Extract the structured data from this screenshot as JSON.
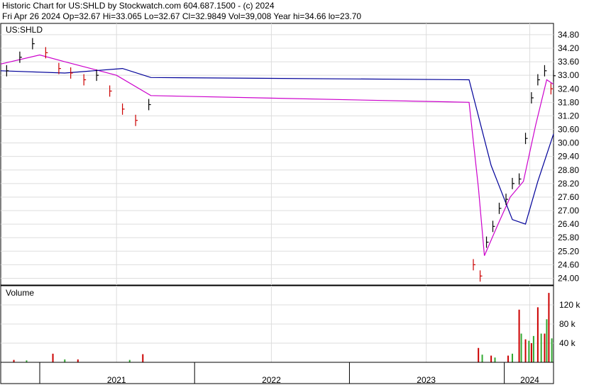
{
  "header": {
    "line1": "Historic Chart for US:SHLD by Stockwatch.com 604.687.1500 - (c) 2024",
    "line2": "Fri Apr 26 2024   Op=32.67  Hi=33.065  Lo=32.67  Cl=32.9849  Vol=39,008  Year hi=34.66  lo=23.70"
  },
  "colors": {
    "price_up": "#000000",
    "price_down": "#cc0000",
    "ma_short": "#cc00cc",
    "ma_long": "#000099",
    "vol_up": "#33aa33",
    "vol_down": "#cc0000",
    "grid": "#dddddd"
  },
  "chart_data": [
    {
      "type": "candlestick",
      "title": "US:SHLD",
      "y_ticks": [
        "34.80",
        "34.20",
        "33.60",
        "33.00",
        "32.40",
        "31.80",
        "31.20",
        "30.60",
        "30.00",
        "29.40",
        "28.80",
        "28.20",
        "27.60",
        "27.00",
        "26.40",
        "25.80",
        "25.20",
        "24.60",
        "24.00"
      ],
      "ylim": [
        23.7,
        35.3
      ],
      "x_ticks": [
        "2021",
        "2022",
        "2023",
        "2024"
      ],
      "x_tick_dates": [
        "2021-07-01",
        "2022-07-01",
        "2023-07-01",
        "2024-03-01"
      ],
      "date_range": [
        "2020-10-01",
        "2024-04-26"
      ],
      "grid": true,
      "series": [
        {
          "name": "",
          "kind": "price",
          "x": [
            "2020-10-15",
            "2020-11-15",
            "2020-12-15",
            "2021-01-15",
            "2021-02-15",
            "2021-03-15",
            "2021-04-15",
            "2021-05-15",
            "2021-06-15",
            "2021-07-15",
            "2021-08-15",
            "2021-09-15",
            "2023-10-20",
            "2023-11-05",
            "2023-11-20",
            "2023-12-05",
            "2023-12-20",
            "2024-01-05",
            "2024-01-20",
            "2024-02-05",
            "2024-02-20",
            "2024-03-05",
            "2024-03-20",
            "2024-04-05",
            "2024-04-20",
            "2024-04-26"
          ],
          "y": [
            33.2,
            33.8,
            34.4,
            34.0,
            33.3,
            33.1,
            32.8,
            33.0,
            32.3,
            31.5,
            31.0,
            31.7,
            24.6,
            24.1,
            25.6,
            26.3,
            27.1,
            27.5,
            28.2,
            28.4,
            30.2,
            32.0,
            32.8,
            33.2,
            32.4,
            32.98
          ]
        },
        {
          "name": "",
          "kind": "ma_short",
          "x": [
            "2020-10-01",
            "2021-01-01",
            "2021-03-01",
            "2021-05-01",
            "2021-07-01",
            "2021-09-20",
            "2023-10-10",
            "2023-11-01",
            "2023-11-15",
            "2023-12-15",
            "2024-01-15",
            "2024-02-15",
            "2024-03-15",
            "2024-04-10",
            "2024-04-26"
          ],
          "y": [
            33.5,
            33.9,
            33.6,
            33.3,
            33.0,
            32.1,
            31.8,
            28.0,
            25.0,
            26.3,
            27.6,
            28.3,
            30.8,
            32.8,
            32.6
          ]
        },
        {
          "name": "",
          "kind": "ma_long",
          "x": [
            "2020-10-01",
            "2021-03-01",
            "2021-07-15",
            "2021-09-20",
            "2023-10-10",
            "2023-12-01",
            "2024-01-20",
            "2024-02-20",
            "2024-03-20",
            "2024-04-26"
          ],
          "y": [
            33.2,
            33.1,
            33.3,
            32.9,
            32.8,
            29.0,
            26.6,
            26.4,
            28.3,
            30.4
          ]
        }
      ]
    },
    {
      "type": "bar",
      "title": "Volume",
      "y_ticks": [
        "120 k",
        "80 k",
        "40 k"
      ],
      "ylim": [
        0,
        160000
      ],
      "grid": true,
      "series": [
        {
          "name": "",
          "kind": "volume_down",
          "x": [
            "2020-11-01",
            "2021-02-01",
            "2021-04-01",
            "2021-09-01",
            "2023-11-01",
            "2023-12-01",
            "2024-01-10",
            "2024-02-05",
            "2024-02-20",
            "2024-03-05",
            "2024-03-20",
            "2024-04-05",
            "2024-04-15"
          ],
          "y": [
            5000,
            18000,
            6000,
            17000,
            30000,
            14000,
            14000,
            110000,
            48000,
            40000,
            115000,
            60000,
            145000
          ]
        },
        {
          "name": "",
          "kind": "volume_up",
          "x": [
            "2020-12-01",
            "2021-03-01",
            "2021-08-01",
            "2023-11-10",
            "2023-12-10",
            "2024-01-20",
            "2024-02-10",
            "2024-02-28",
            "2024-03-10",
            "2024-03-28",
            "2024-04-10",
            "2024-04-22"
          ],
          "y": [
            4000,
            6000,
            5000,
            16000,
            10000,
            18000,
            60000,
            45000,
            55000,
            60000,
            90000,
            50000
          ]
        }
      ]
    }
  ]
}
